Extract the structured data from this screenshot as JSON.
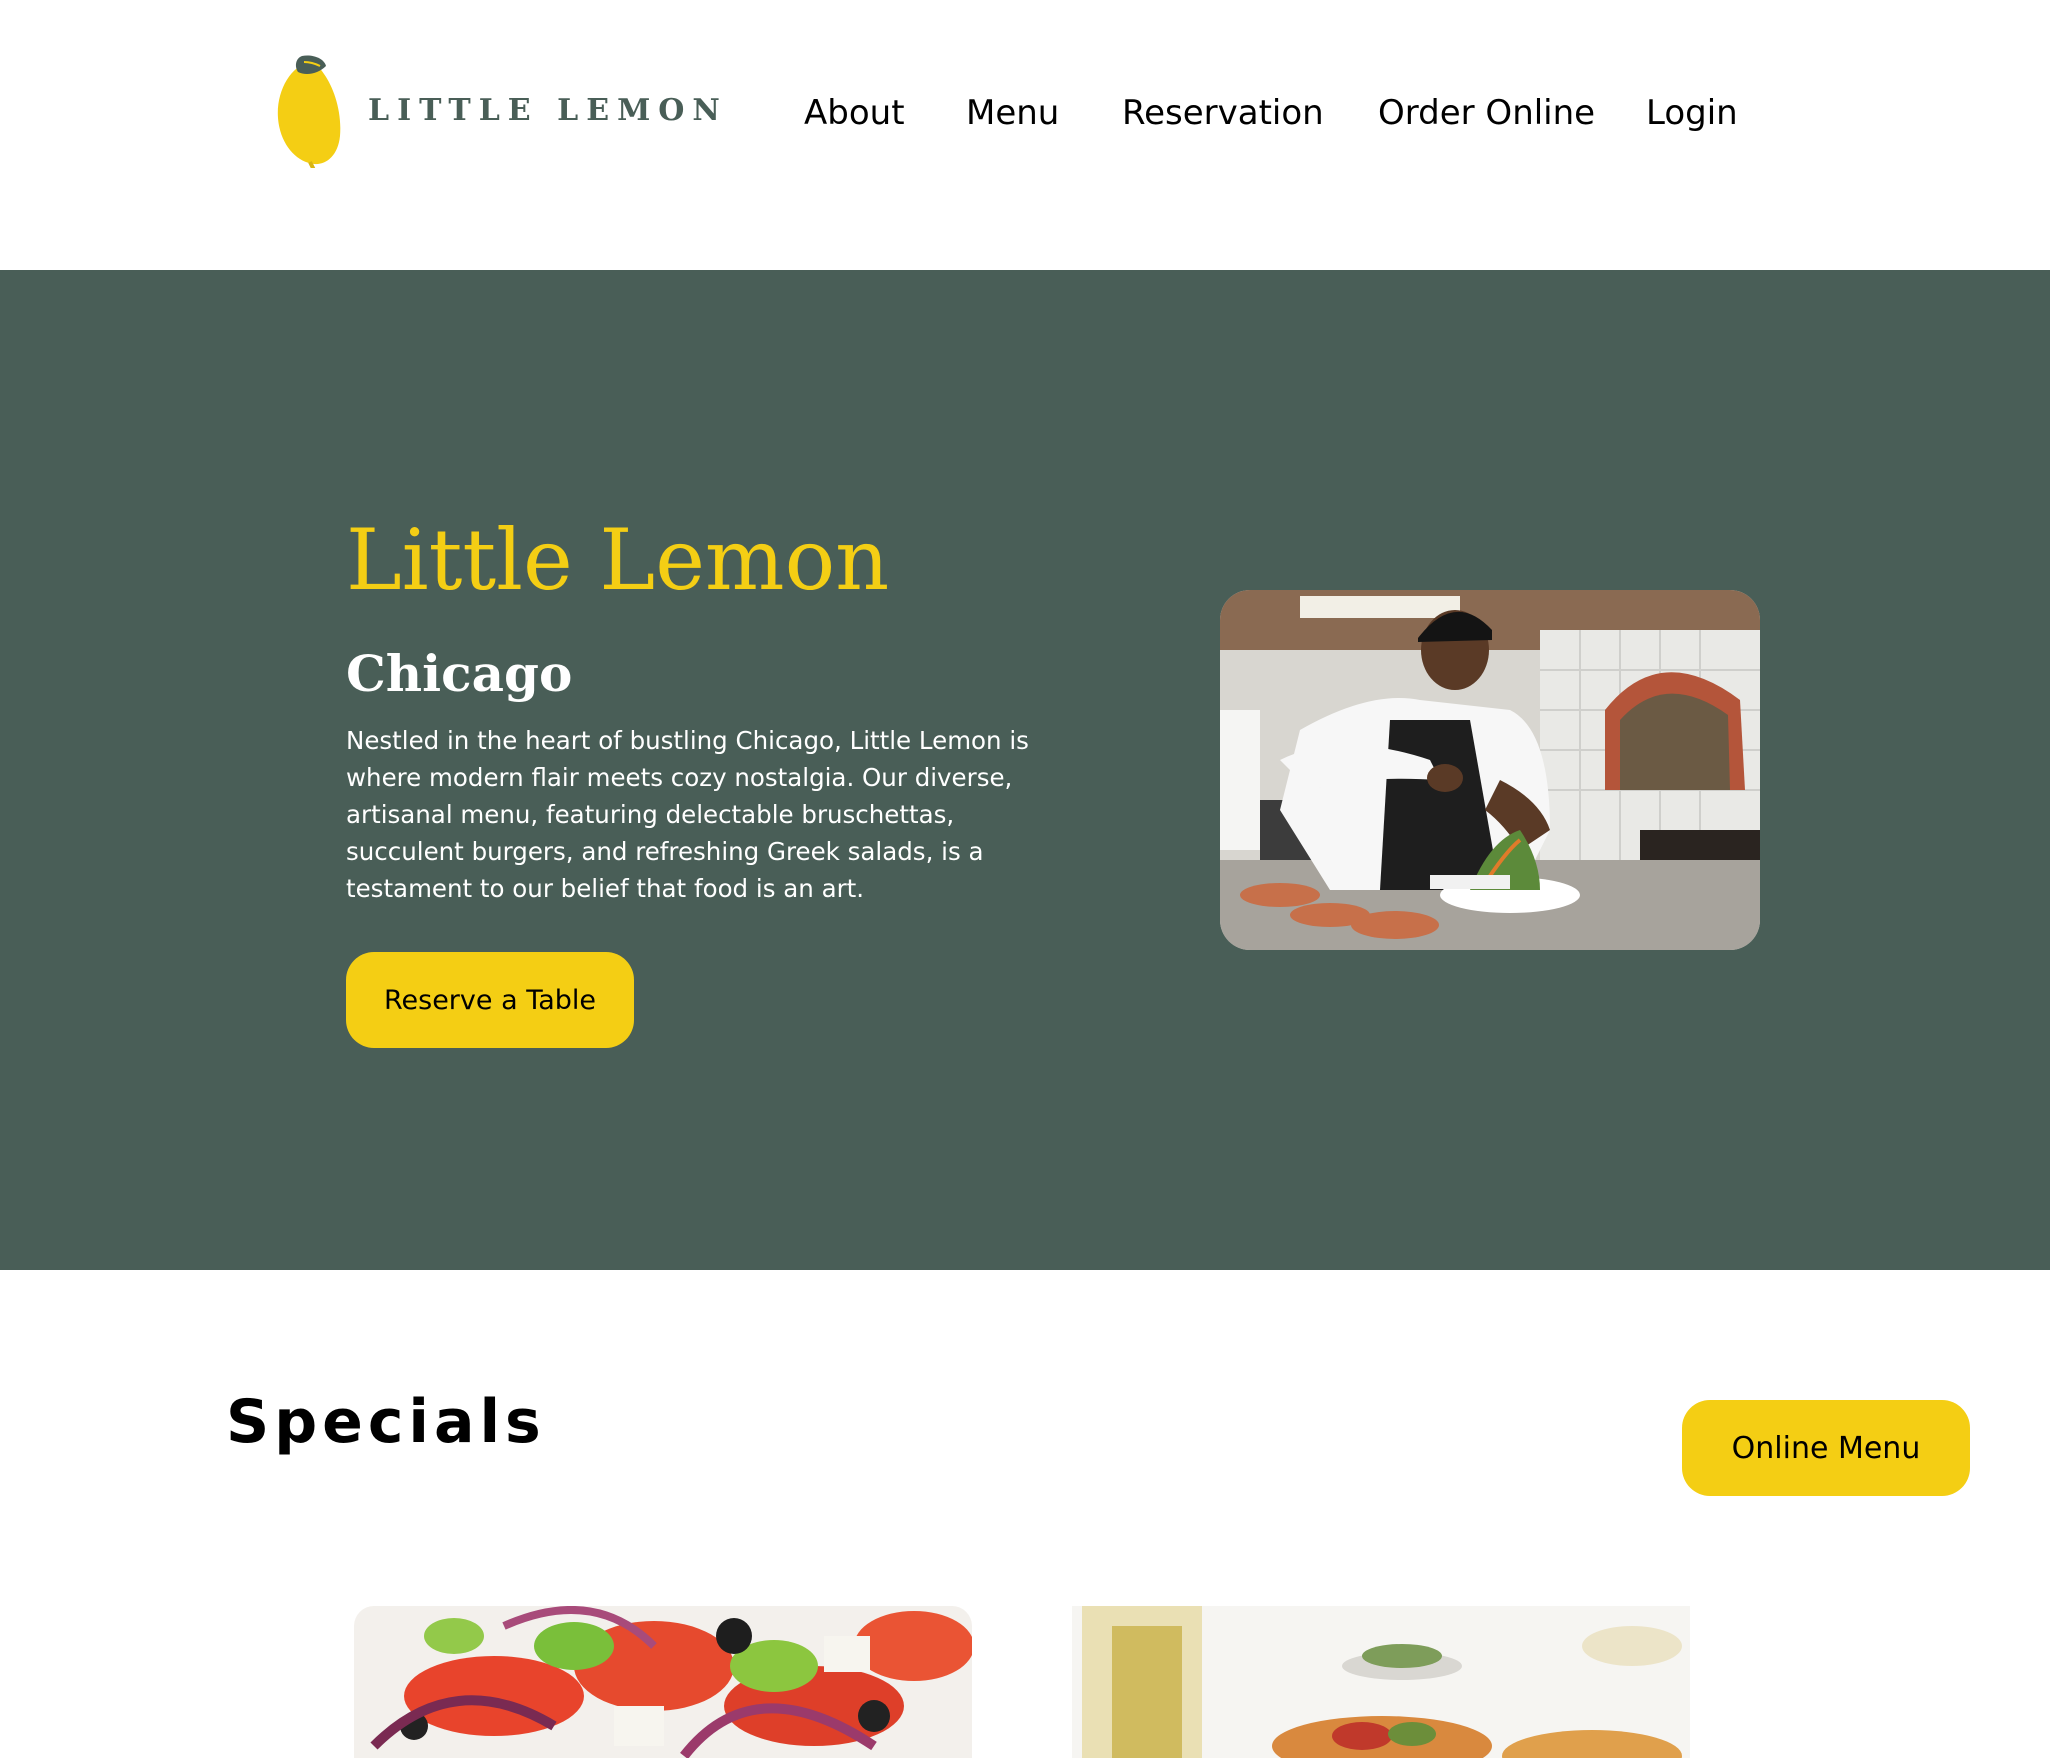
{
  "header": {
    "logo_text": "LITTLE LEMON",
    "nav": [
      {
        "label": "About"
      },
      {
        "label": "Menu"
      },
      {
        "label": "Reservation"
      },
      {
        "label": "Order Online"
      },
      {
        "label": "Login"
      }
    ]
  },
  "hero": {
    "title": "Little Lemon",
    "subtitle": "Chicago",
    "description": "Nestled in the heart of bustling Chicago, Little Lemon is where modern flair meets cozy nostalgia. Our diverse, artisanal menu, featuring delectable bruschettas, succulent burgers, and refreshing Greek salads, is a testament to our belief that food is an art.",
    "cta_label": "Reserve a Table",
    "photo": "chef-plating-salad-photo"
  },
  "specials": {
    "title": "Specials",
    "cta_label": "Online Menu",
    "cards": [
      {
        "photo": "greek-salad-photo"
      },
      {
        "photo": "bruschetta-photo"
      }
    ]
  },
  "colors": {
    "primary_green": "#495e57",
    "primary_yellow": "#f4ce14",
    "white": "#ffffff",
    "black": "#000000"
  }
}
